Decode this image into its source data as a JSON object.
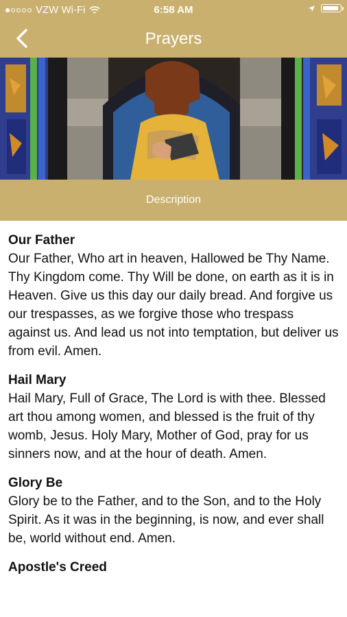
{
  "status": {
    "carrier": "VZW Wi-Fi",
    "time": "6:58 AM"
  },
  "nav": {
    "title": "Prayers"
  },
  "hero": {
    "icon": "stained-glass-image"
  },
  "description_label": "Description",
  "prayers": [
    {
      "title": "Our Father",
      "text": "Our Father, Who art in heaven, Hallowed be Thy Name. Thy Kingdom come. Thy Will be done, on earth as it is in Heaven. Give us this day our daily bread. And forgive us our trespasses, as we forgive those who trespass against us. And lead us not into temptation, but deliver us from evil. Amen."
    },
    {
      "title": "Hail Mary",
      "text": "Hail Mary, Full of Grace, The Lord is with thee. Blessed art thou among women, and blessed is the fruit of thy womb, Jesus. Holy Mary, Mother of God, pray for us sinners now, and at the hour of death. Amen."
    },
    {
      "title": "Glory Be",
      "text": "Glory be to the Father, and to the Son, and to the Holy Spirit. As it was in the beginning, is now, and ever shall be, world without end. Amen."
    },
    {
      "title": "Apostle's Creed",
      "text": ""
    }
  ],
  "colors": {
    "gold": "#c9b06f"
  }
}
